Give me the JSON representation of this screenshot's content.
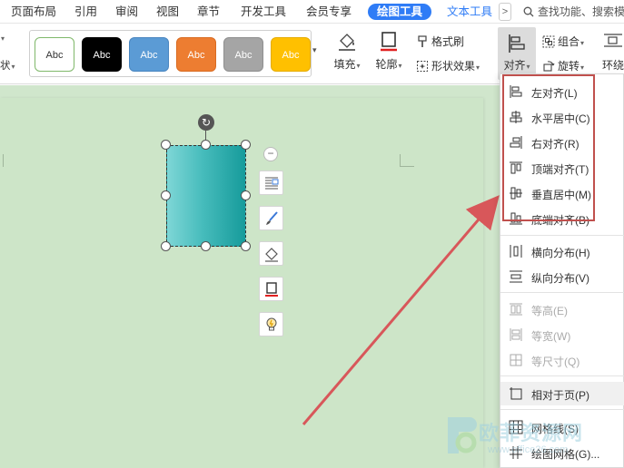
{
  "tabs": [
    {
      "label": "页面布局",
      "active": false
    },
    {
      "label": "引用",
      "active": false
    },
    {
      "label": "审阅",
      "active": false
    },
    {
      "label": "视图",
      "active": false
    },
    {
      "label": "章节",
      "active": false
    },
    {
      "label": "开发工具",
      "active": false
    },
    {
      "label": "会员专享",
      "active": false
    },
    {
      "label": "绘图工具",
      "active": true
    },
    {
      "label": "文本工具",
      "active": false
    }
  ],
  "tab_more": ">",
  "search_placeholder": "查找功能、搜索模",
  "ribbon": {
    "left_fragment_2": "状",
    "style_gallery": [
      {
        "label": "Abc",
        "bg": "#ffffff",
        "fg": "#333333",
        "border": "#7fb86a"
      },
      {
        "label": "Abc",
        "bg": "#000000",
        "fg": "#ffffff",
        "border": "#000000"
      },
      {
        "label": "Abc",
        "bg": "#5b9bd5",
        "fg": "#ffffff",
        "border": "#4a86c0"
      },
      {
        "label": "Abc",
        "bg": "#ed7d31",
        "fg": "#ffffff",
        "border": "#d96c22"
      },
      {
        "label": "Abc",
        "bg": "#a5a5a5",
        "fg": "#ffffff",
        "border": "#8f8f8f"
      },
      {
        "label": "Abc",
        "bg": "#ffc000",
        "fg": "#ffffff",
        "border": "#e6ac00"
      }
    ],
    "fill_label": "填充",
    "outline_label": "轮廓",
    "format_painter_label": "格式刷",
    "shape_effect_label": "形状效果",
    "align_label": "对齐",
    "group_label": "组合",
    "rotate_label": "旋转",
    "wrap_label": "环绕"
  },
  "align_menu": {
    "items": [
      {
        "label": "左对齐(L)",
        "icon": "align-left-icon",
        "disabled": false
      },
      {
        "label": "水平居中(C)",
        "icon": "align-center-icon",
        "disabled": false
      },
      {
        "label": "右对齐(R)",
        "icon": "align-right-icon",
        "disabled": false
      },
      {
        "label": "顶端对齐(T)",
        "icon": "align-top-icon",
        "disabled": false
      },
      {
        "label": "垂直居中(M)",
        "icon": "align-middle-icon",
        "disabled": false
      },
      {
        "label": "底端对齐(B)",
        "icon": "align-bottom-icon",
        "disabled": false
      },
      {
        "label": "横向分布(H)",
        "icon": "distribute-horizontal-icon",
        "disabled": false
      },
      {
        "label": "纵向分布(V)",
        "icon": "distribute-vertical-icon",
        "disabled": false
      },
      {
        "label": "等高(E)",
        "icon": "same-height-icon",
        "disabled": true
      },
      {
        "label": "等宽(W)",
        "icon": "same-width-icon",
        "disabled": true
      },
      {
        "label": "等尺寸(Q)",
        "icon": "same-size-icon",
        "disabled": true
      },
      {
        "label": "相对于页(P)",
        "icon": "relative-page-icon",
        "disabled": false,
        "selected": true
      },
      {
        "label": "网格线(S)",
        "icon": "gridlines-icon",
        "disabled": false
      },
      {
        "label": "绘图网格(G)...",
        "icon": "drawing-grid-icon",
        "disabled": false
      }
    ]
  },
  "watermark": {
    "text": "欧菲资源网",
    "url": "www.office26.com"
  },
  "colors": {
    "accent": "#2f7cf6",
    "highlight": "#c0504d",
    "doc_bg": "#cde5c8",
    "shape_dark": "#169b9b",
    "shape_light": "#7ed6d6"
  }
}
